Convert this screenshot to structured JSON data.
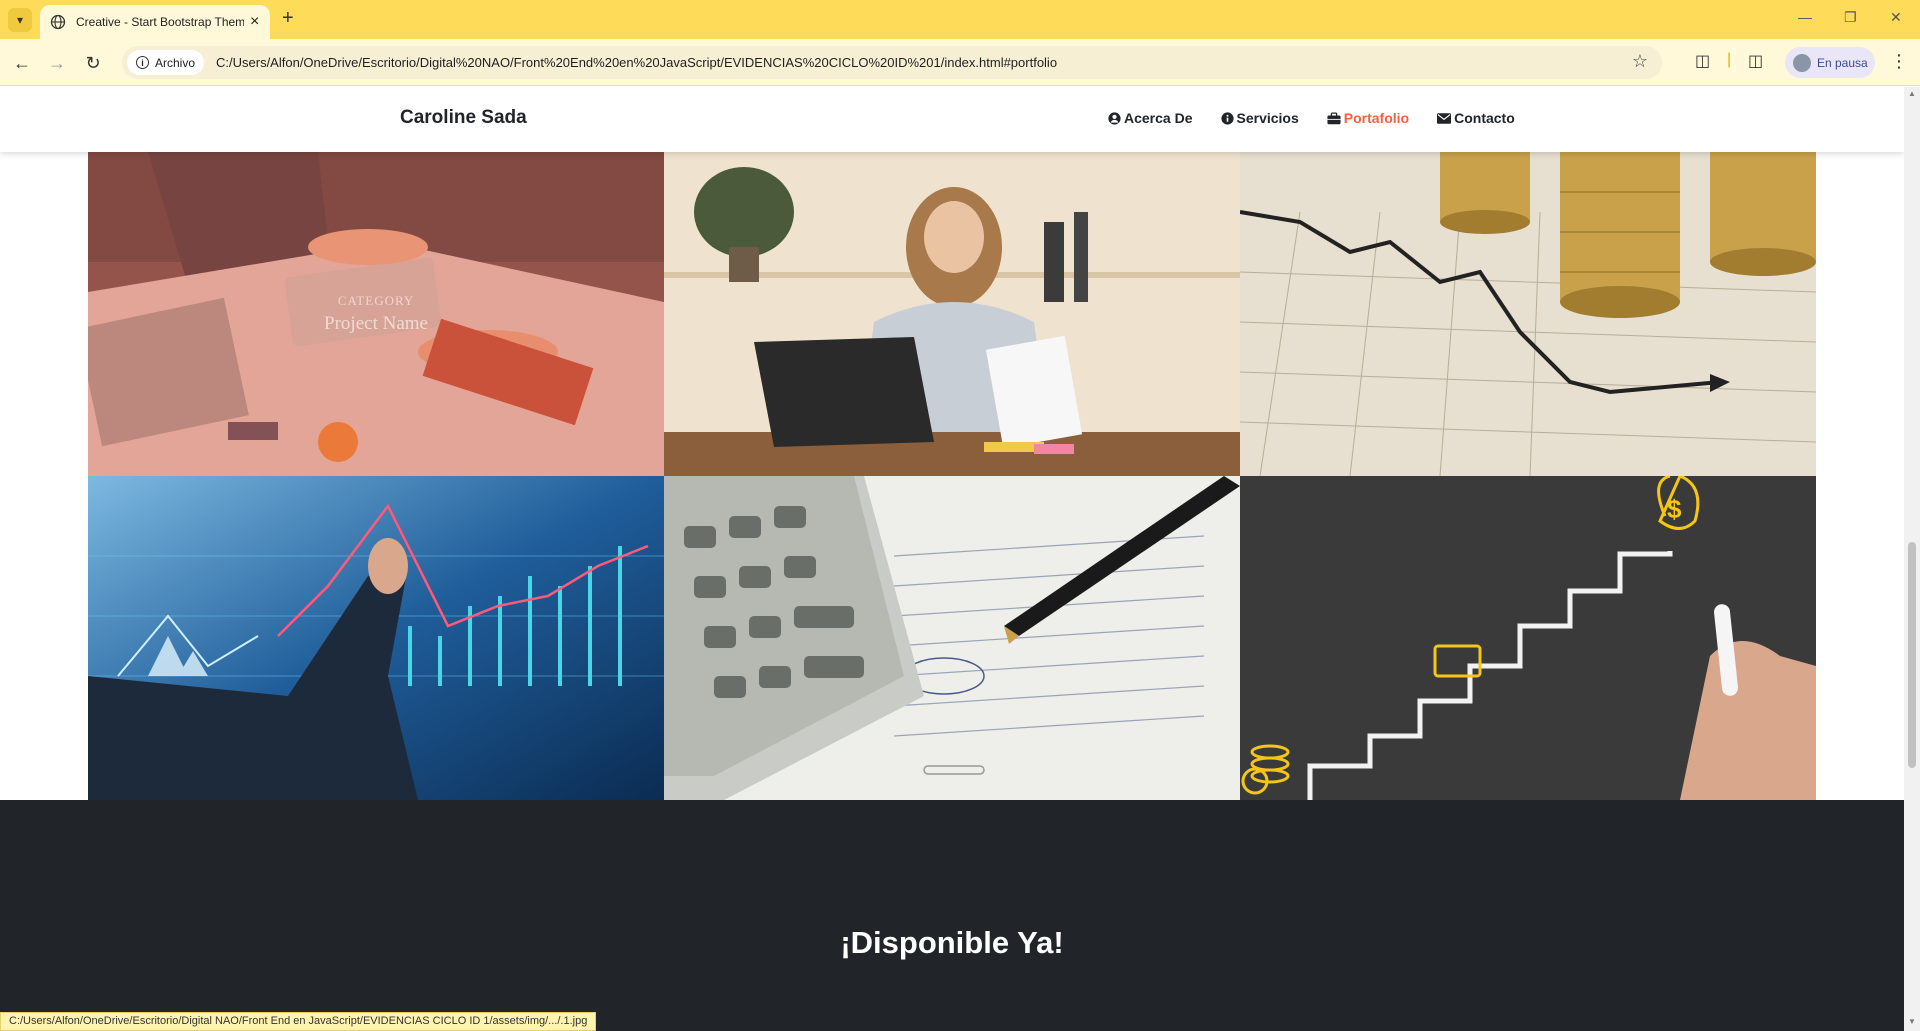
{
  "browser": {
    "tab_title": "Creative - Start Bootstrap Them",
    "address_chip": "Archivo",
    "url": "C:/Users/Alfon/OneDrive/Escritorio/Digital%20NAO/Front%20End%20en%20JavaScript/EVIDENCIAS%20CICLO%20ID%201/index.html#portfolio",
    "profile_label": "En pausa",
    "status_url": "C:/Users/Alfon/OneDrive/Escritorio/Digital NAO/Front End en JavaScript/EVIDENCIAS CICLO ID 1/assets/img/.../.1.jpg",
    "icons": [
      "tab-search-icon",
      "globe-icon",
      "close-icon",
      "plus-icon",
      "minimize-icon",
      "maximize-icon",
      "back-icon",
      "forward-icon",
      "reload-icon",
      "info-icon",
      "star-icon",
      "extensions-icon",
      "sidepanel-icon",
      "kebab-icon"
    ]
  },
  "site": {
    "brand": "Caroline Sada",
    "nav": [
      {
        "label": "Acerca De",
        "icon": "user-circle-icon",
        "active": false
      },
      {
        "label": "Servicios",
        "icon": "info-circle-icon",
        "active": false
      },
      {
        "label": "Portafolio",
        "icon": "briefcase-icon",
        "active": true
      },
      {
        "label": "Contacto",
        "icon": "envelope-icon",
        "active": false
      }
    ],
    "accent_color": "#f4623a",
    "portfolio": {
      "hover_category": "CATEGORY",
      "hover_project": "Project Name",
      "tiles": [
        "business-meeting-image",
        "woman-laptop-image",
        "coins-chart-image",
        "stock-chart-image",
        "calculator-image",
        "chalkboard-stairs-image"
      ]
    },
    "cta_title": "¡Disponible Ya!"
  }
}
